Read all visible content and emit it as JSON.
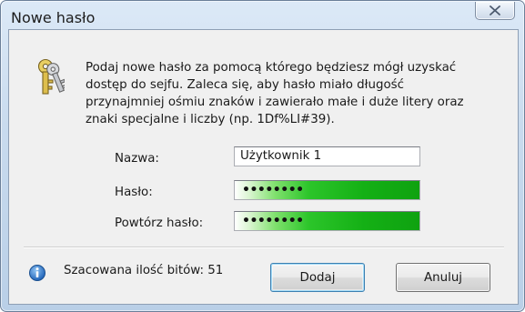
{
  "window": {
    "title": "Nowe hasło",
    "close_icon": "close-icon"
  },
  "header": {
    "icon": "keys-icon",
    "description": "Podaj nowe hasło za pomocą którego będziesz mógł uzyskać\ndostęp do sejfu. Zaleca się, aby hasło miało długość\nprzynajmniej ośmiu znaków i zawierało małe i duże litery oraz\nznaki specjalne i liczby (np. 1Df%LI#39)."
  },
  "form": {
    "name_label": "Nazwa:",
    "name_value": "Użytkownik 1",
    "password_label": "Hasło:",
    "password_value": "••••••••",
    "repeat_label": "Powtórz hasło:",
    "repeat_value": "••••••••",
    "strength_color": "#1db21b"
  },
  "footer": {
    "info_icon": "info-icon",
    "bits_text": "Szacowana ilość bitów: 51",
    "add_button": "Dodaj",
    "cancel_button": "Anuluj"
  }
}
